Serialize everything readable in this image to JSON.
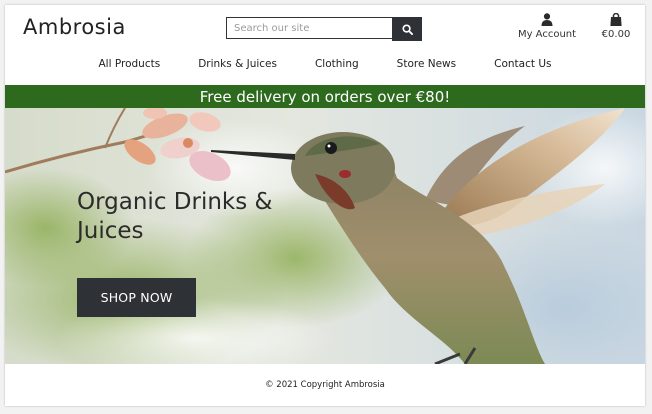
{
  "header": {
    "logo": "Ambrosia",
    "search": {
      "placeholder": "Search our site",
      "value": ""
    },
    "account_label": "My Account",
    "bag_total": "€0.00"
  },
  "nav": {
    "items": [
      {
        "label": "All Products"
      },
      {
        "label": "Drinks & Juices"
      },
      {
        "label": "Clothing"
      },
      {
        "label": "Store News"
      },
      {
        "label": "Contact Us"
      }
    ]
  },
  "banner": {
    "text": "Free delivery on orders over €80!"
  },
  "hero": {
    "title": "Organic Drinks & Juices",
    "cta_label": "SHOP NOW"
  },
  "footer": {
    "copyright": "© 2021 Copyright Ambrosia"
  },
  "colors": {
    "banner_bg": "#2d6a1e",
    "button_bg": "#2e3136",
    "text": "#222222"
  },
  "icons": [
    "search-icon",
    "user-icon",
    "shopping-bag-icon"
  ]
}
